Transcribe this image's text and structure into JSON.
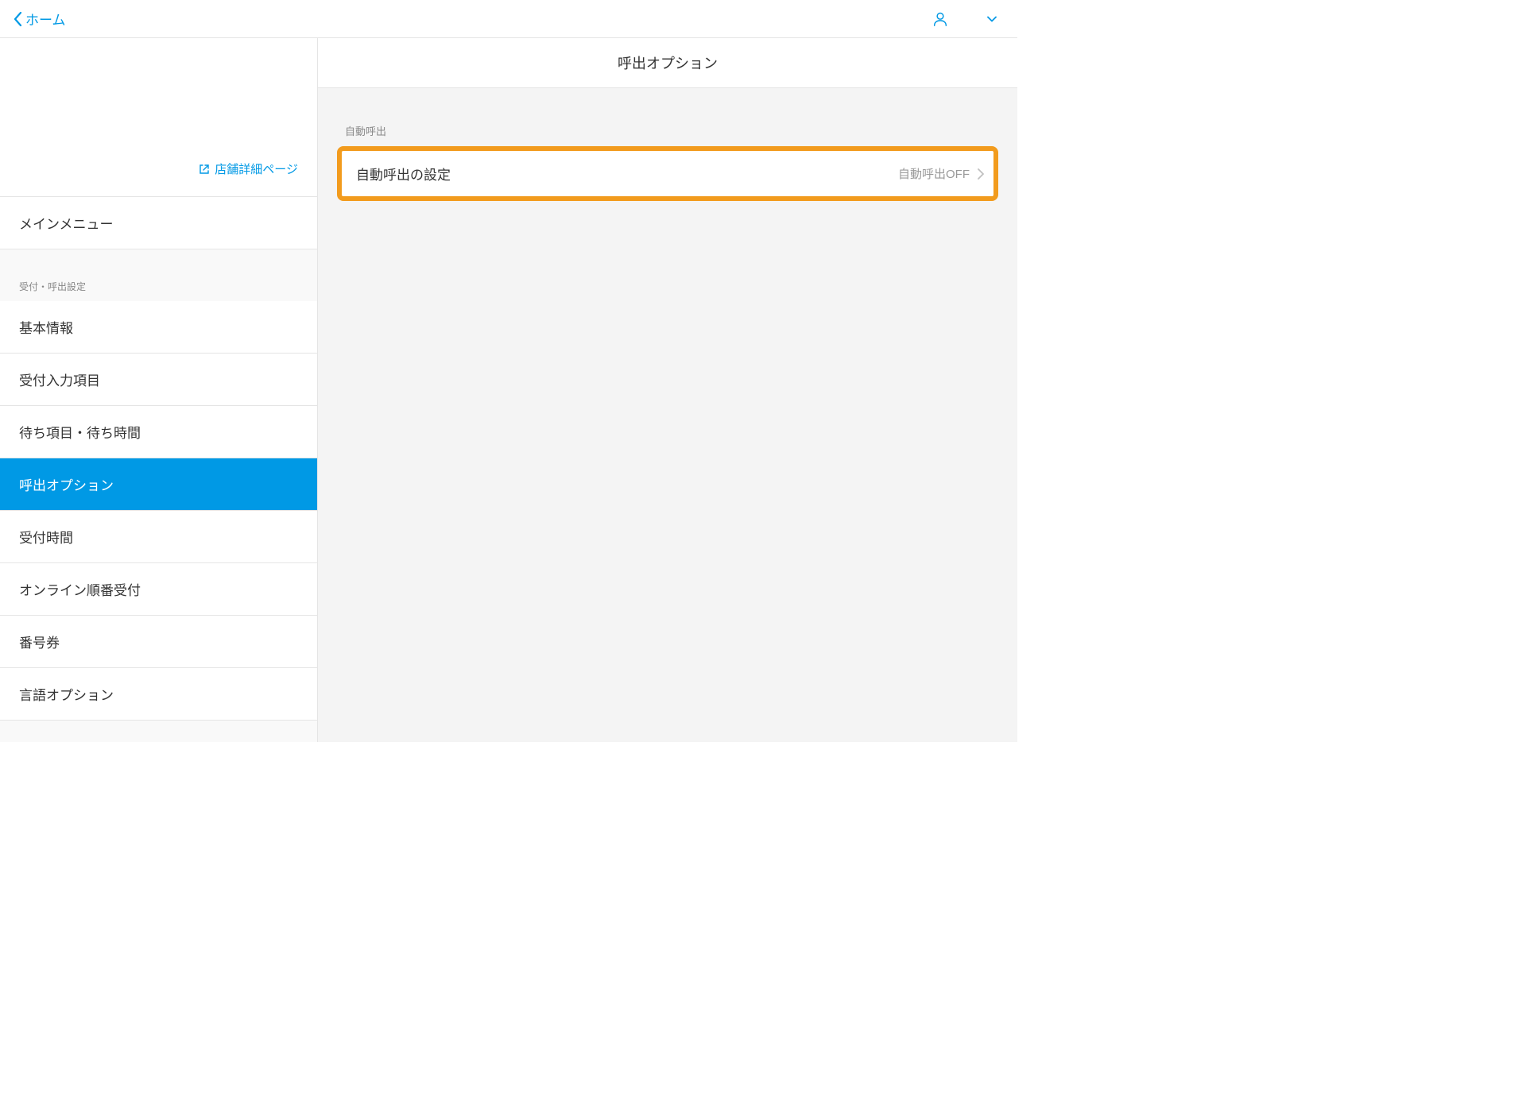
{
  "topbar": {
    "back_label": "ホーム"
  },
  "sidebar": {
    "store_link_label": "店舗詳細ページ",
    "main_menu_label": "メインメニュー",
    "section_header": "受付・呼出設定",
    "items": [
      {
        "label": "基本情報",
        "active": false
      },
      {
        "label": "受付入力項目",
        "active": false
      },
      {
        "label": "待ち項目・待ち時間",
        "active": false
      },
      {
        "label": "呼出オプション",
        "active": true
      },
      {
        "label": "受付時間",
        "active": false
      },
      {
        "label": "オンライン順番受付",
        "active": false
      },
      {
        "label": "番号券",
        "active": false
      },
      {
        "label": "言語オプション",
        "active": false
      }
    ]
  },
  "panel": {
    "title": "呼出オプション",
    "group_label": "自動呼出",
    "setting": {
      "label": "自動呼出の設定",
      "value": "自動呼出OFF"
    }
  }
}
